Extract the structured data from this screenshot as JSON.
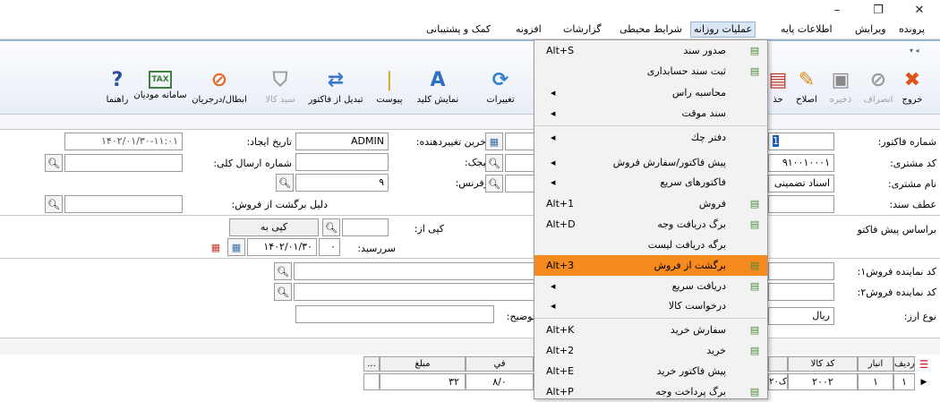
{
  "window": {
    "minimize": "–",
    "restore": "❐",
    "close": "✕"
  },
  "menu": {
    "items": [
      {
        "label": "پرونده"
      },
      {
        "label": "ویرایش"
      },
      {
        "label": "اطلاعات پایه"
      },
      {
        "label": "عملیات روزانه"
      },
      {
        "label": "شرایط محیطی"
      },
      {
        "label": "گزارشات"
      },
      {
        "label": "افزونه"
      },
      {
        "label": "کمک و پشتیبانی"
      }
    ],
    "overflow": "▾ ◂"
  },
  "toolbar": {
    "buttons": [
      {
        "label": "خروج",
        "icon": "exit-icon",
        "glyph": "✖",
        "color": "#e0541c"
      },
      {
        "label": "انصراف",
        "icon": "cancel-icon",
        "glyph": "⊘",
        "color": "#9a9a9a"
      },
      {
        "label": "ذخیره",
        "icon": "save-icon",
        "glyph": "▣",
        "color": "#8a8a8a"
      },
      {
        "label": "اصلاح",
        "icon": "edit-icon",
        "glyph": "✎",
        "color": "#d98a1a"
      },
      {
        "label": "حذ",
        "icon": "delete-icon",
        "glyph": "▤",
        "color": "#c0392b"
      },
      {
        "label": "تغییرات",
        "icon": "refresh-icon",
        "glyph": "⟳",
        "color": "#2f7fd1"
      },
      {
        "label": "نمایش کلید",
        "icon": "keyboard-icon",
        "glyph": "A",
        "color": "#2d6fc4"
      },
      {
        "label": "پیوست",
        "icon": "attachment-icon",
        "glyph": "❘",
        "color": "#d9a21b"
      },
      {
        "label": "تبدیل از فاکتور",
        "icon": "convert-icon",
        "glyph": "⇄",
        "color": "#3a78c9"
      },
      {
        "label": "سبد کالا",
        "icon": "basket-icon",
        "glyph": "⛉",
        "color": "#9a9a9a"
      },
      {
        "label": "ابطال/درجریان",
        "icon": "void-icon",
        "glyph": "⊘",
        "color": "#e06a2a"
      },
      {
        "label": "سامانه مودیان",
        "icon": "tax-icon",
        "glyph": "TAX",
        "color": "#3e7e3e"
      },
      {
        "label": "راهنما",
        "icon": "help-icon",
        "glyph": "?",
        "color": "#2d4fa0"
      }
    ]
  },
  "form": {
    "invoice_no_label": "شماره فاکتور:",
    "invoice_no": "1",
    "customer_code_label": "کد مشتری:",
    "customer_code": "۹۱۰۰۱۰۰۰۱",
    "customer_name_label": "نام مشتری:",
    "customer_name": "اسناد تضمینی",
    "sanad_ref_label": "عطف سند:",
    "last_modifier_label": "آخرین تغییردهنده:",
    "last_modifier": "ADMIN",
    "bijak_label": "بیجک:",
    "reference_label": "رفرنس:",
    "reference": "۹",
    "created_date_label": "تاریخ ایجاد:",
    "created_date": "۱۴۰۲/۰۱/۳۰-۱۱:۰۱",
    "total_send_label": "شماره ارسال کلی:",
    "return_reason_label": "دلیل برگشت از فروش:",
    "based_on_label": "براساس پیش فاکتو",
    "copy_from_label": "کپی از:",
    "copy_to_button": "کپی به",
    "due_label": "سررسید:",
    "due_days": "۰",
    "due_date": "۱۴۰۲/۰۱/۳۰",
    "agent1_label": "کد نماینده فروش۱:",
    "agent2_label": "کد نماینده فروش۲:",
    "currency_label": "نوع ارز:",
    "currency": "ریال",
    "description_label": "توضیح:"
  },
  "dropdown": {
    "items": [
      {
        "label": "صدور سند",
        "shortcut": "Alt+S",
        "submenu": false,
        "icon": "voucher-issue-icon"
      },
      {
        "label": "ثبت سند حسابداری",
        "shortcut": "",
        "submenu": false,
        "icon": "accounting-voucher-icon"
      },
      {
        "label": "محاسبه راس",
        "shortcut": "",
        "submenu": true,
        "icon": ""
      },
      {
        "label": "سند موقت",
        "shortcut": "",
        "submenu": true,
        "icon": ""
      },
      {
        "label": "دفتر چك",
        "shortcut": "",
        "submenu": true,
        "icon": ""
      },
      {
        "label": "پیش فاکتور/سفارش فروش",
        "shortcut": "",
        "submenu": true,
        "icon": ""
      },
      {
        "label": "فاكتورهای سریع",
        "shortcut": "",
        "submenu": true,
        "icon": ""
      },
      {
        "label": "فروش",
        "shortcut": "Alt+1",
        "submenu": false,
        "icon": "sales-icon"
      },
      {
        "label": "برگ دریافت وجه",
        "shortcut": "Alt+D",
        "submenu": false,
        "icon": "receipt-icon"
      },
      {
        "label": "برگه دریافت لیست",
        "shortcut": "",
        "submenu": false,
        "icon": ""
      },
      {
        "label": "برگشت از فروش",
        "shortcut": "Alt+3",
        "submenu": false,
        "icon": "sales-return-icon",
        "highlight": true
      },
      {
        "label": "دریافت سریع",
        "shortcut": "",
        "submenu": true,
        "icon": "quick-receipt-icon"
      },
      {
        "label": "درخواست کالا",
        "shortcut": "",
        "submenu": true,
        "icon": ""
      },
      {
        "label": "سفارش خرید",
        "shortcut": "Alt+K",
        "submenu": false,
        "icon": "purchase-order-icon"
      },
      {
        "label": "خرید",
        "shortcut": "Alt+2",
        "submenu": false,
        "icon": "purchase-icon"
      },
      {
        "label": "پیش فاكتور خرید",
        "shortcut": "Alt+E",
        "submenu": false,
        "icon": ""
      },
      {
        "label": "برگ پرداخت وجه",
        "shortcut": "Alt+P",
        "submenu": false,
        "icon": "payment-icon"
      }
    ],
    "highlight_color": "#f58a1f"
  },
  "grid": {
    "headers_right": [
      "ردیف",
      "انبار",
      "کد کالا"
    ],
    "headers_left": [
      "...",
      "مبلغ",
      "في"
    ],
    "row": {
      "index": "۱",
      "warehouse": "۱",
      "item_code": "۲۰۰۲",
      "code_fragment": "ک۲۰",
      "amount": "۳۲",
      "price": "۸/۰"
    }
  }
}
